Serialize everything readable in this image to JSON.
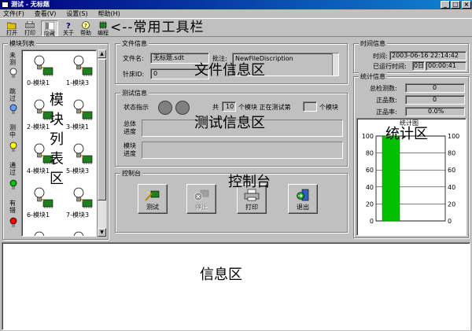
{
  "window": {
    "title": "测试 - 无标题",
    "min": "_",
    "max": "□",
    "close": "×"
  },
  "menu": {
    "items": [
      "文件(F)",
      "查看(V)",
      "设置(S)",
      "帮助(H)"
    ]
  },
  "toolbar": {
    "buttons": [
      {
        "label": "打开",
        "icon": "open-folder-icon"
      },
      {
        "label": "打印",
        "icon": "printer-icon"
      },
      {
        "label": "隐藏",
        "icon": "hide-panel-icon"
      },
      {
        "label": "关于",
        "icon": "question-icon"
      },
      {
        "label": "帮助",
        "icon": "help-icon"
      },
      {
        "label": "编程",
        "icon": "chip-program-icon"
      }
    ],
    "annotation": "<--常用工具栏"
  },
  "module_list": {
    "caption": "模块列表",
    "status_legend": [
      {
        "label": "未测",
        "color": "#ffffff"
      },
      {
        "label": "跳过",
        "color": "#60a0ff"
      },
      {
        "label": "测中",
        "color": "#ffff00"
      },
      {
        "label": "通过",
        "color": "#00c000"
      },
      {
        "label": "有错",
        "color": "#ff0000"
      }
    ],
    "modules": [
      "0-模块1",
      "1-模块3",
      "2-模块1",
      "3-模块1",
      "4-模块1",
      "5-模块3",
      "6-模块1",
      "7-模块3",
      "8-模块1",
      "9-模块3"
    ],
    "annotation": [
      "模",
      "块",
      "列",
      "表",
      "区"
    ]
  },
  "file_info": {
    "caption": "文件信息",
    "filename_label": "文件名:",
    "filename_value": "无标题.sdt",
    "note_label": "批注:",
    "note_value": "NewFileDiscription",
    "bed_label": "针床ID:",
    "bed_value": "0",
    "annotation": "文件信息区"
  },
  "test_info": {
    "caption": "测试信息",
    "status_label": "状态指示",
    "total_prefix": "共",
    "total_count": "10",
    "total_suffix": "个模块 正在测试第",
    "current_suffix": "个模块",
    "overall_progress_label": [
      "总体",
      "进度"
    ],
    "module_progress_label": [
      "模块",
      "进度"
    ],
    "annotation": "测试信息区"
  },
  "console": {
    "caption": "控制台",
    "buttons": [
      {
        "label": "测试",
        "icon": "test-icon",
        "enabled": true
      },
      {
        "label": "停止",
        "icon": "stop-icon",
        "enabled": false
      },
      {
        "label": "打印",
        "icon": "printer-icon",
        "enabled": true
      },
      {
        "label": "退出",
        "icon": "exit-icon",
        "enabled": true
      }
    ],
    "annotation": "控制台"
  },
  "time_info": {
    "caption": "时间信息",
    "time_label": "时间:",
    "time_value": "2003-06-16 22:14:42",
    "run_label": "已运行时间:",
    "run_days": "0日",
    "run_value": "00:00:41"
  },
  "stats": {
    "caption": "统计信息",
    "total_label": "总检测数:",
    "total_value": "0",
    "good_label": "正品数:",
    "good_value": "0",
    "rate_label": "正品率:",
    "rate_value": "0.0%",
    "chart_title": "统计图",
    "annotation": "统计区"
  },
  "chart_data": {
    "type": "bar",
    "title": "统计图",
    "categories": [
      ""
    ],
    "values": [
      100
    ],
    "ylim": [
      0,
      100
    ],
    "yticks": [
      0,
      20,
      40,
      60,
      80,
      100
    ],
    "bar_color": "#00c000",
    "grid": true
  },
  "message_area": {
    "annotation": "信息区"
  }
}
